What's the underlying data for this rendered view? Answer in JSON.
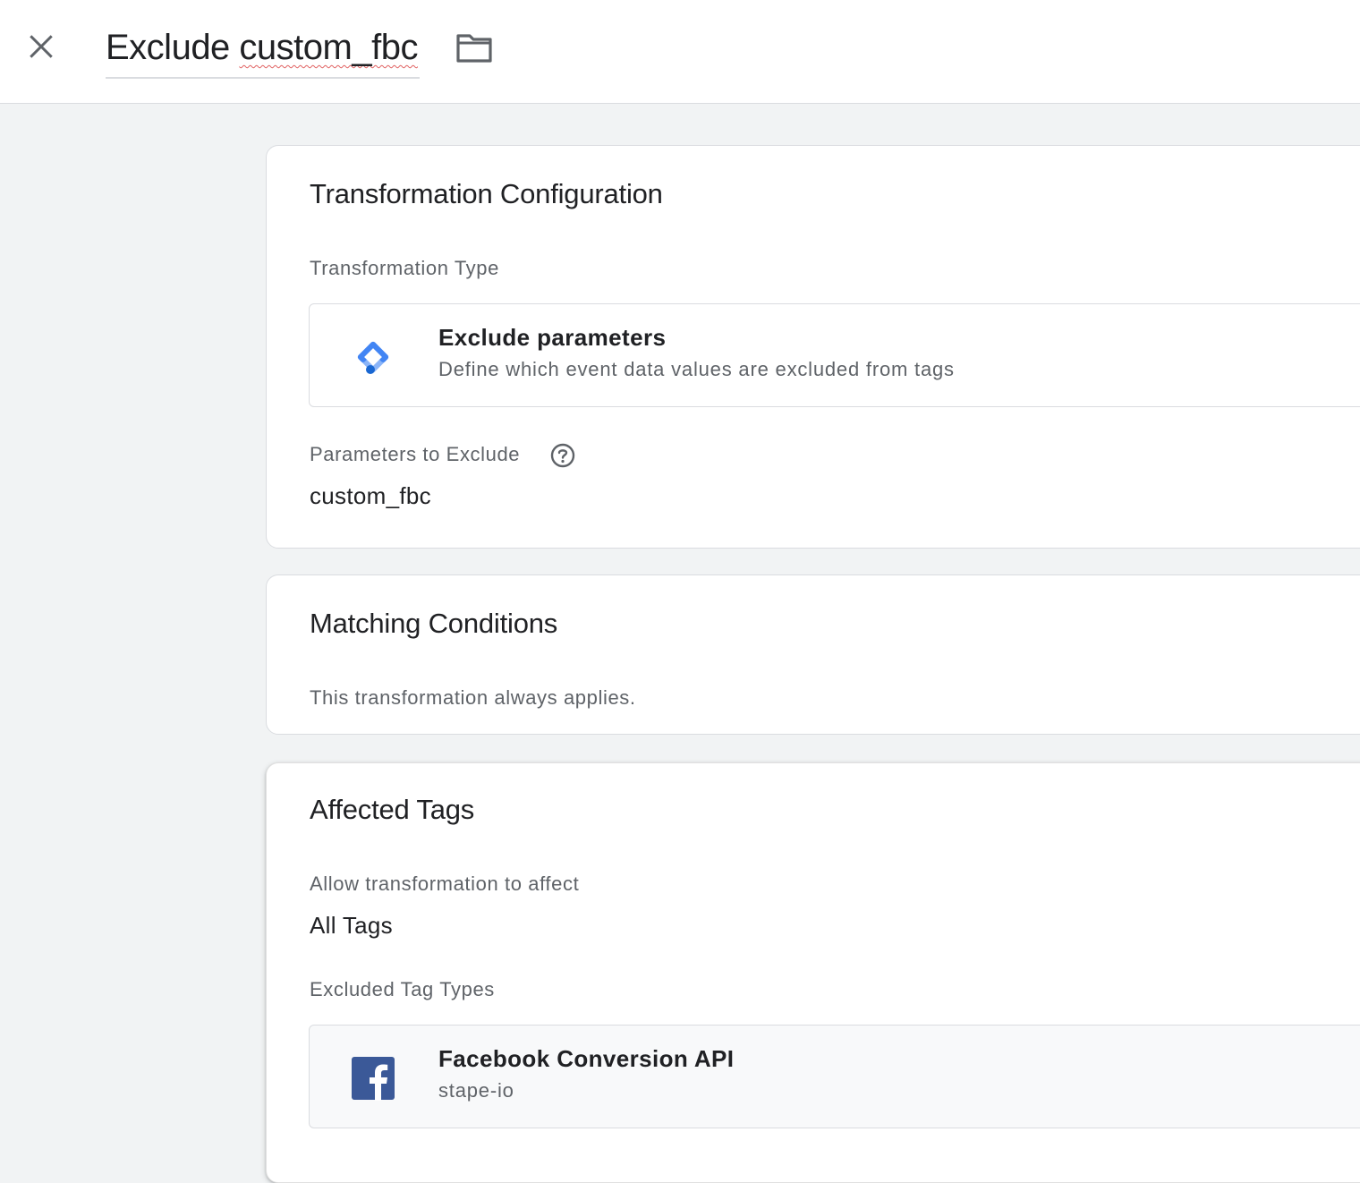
{
  "header": {
    "close_icon": "close-icon",
    "title_prefix": "Exclude ",
    "title_misspelled": "custom_fbc",
    "folder_icon": "folder-icon"
  },
  "transformation_config": {
    "title": "Transformation Configuration",
    "type_label": "Transformation Type",
    "type_option": {
      "icon": "tag-manager-icon",
      "title": "Exclude parameters",
      "subtitle": "Define which event data values are excluded from tags"
    },
    "params_label": "Parameters to Exclude",
    "help_icon": "help-icon",
    "params_value": "custom_fbc"
  },
  "matching_conditions": {
    "title": "Matching Conditions",
    "description": "This transformation always applies."
  },
  "affected_tags": {
    "title": "Affected Tags",
    "allow_label": "Allow transformation to affect",
    "allow_value": "All Tags",
    "excluded_label": "Excluded Tag Types",
    "excluded_tag": {
      "icon": "facebook-icon",
      "title": "Facebook Conversion API",
      "subtitle": "stape-io"
    }
  },
  "colors": {
    "gtm_blue_light": "#8ab4f8",
    "gtm_blue": "#4285f4",
    "gtm_blue_dark": "#1967d2",
    "facebook_blue": "#3b5998"
  }
}
